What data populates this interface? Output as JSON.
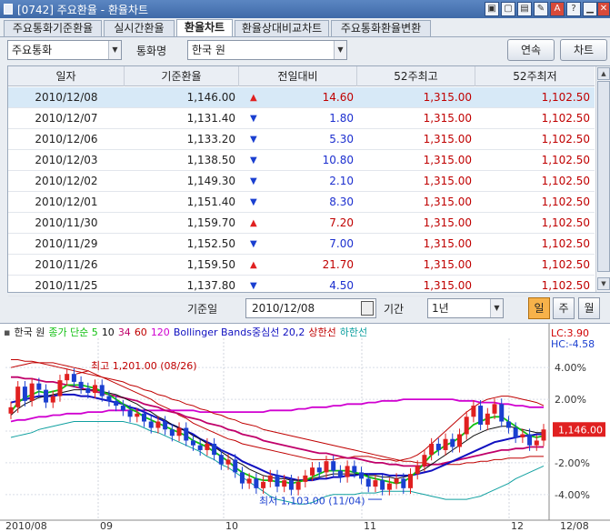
{
  "window": {
    "title": "[0742] 주요환율 - 환율차트"
  },
  "tabs": [
    {
      "label": "주요통화기준환율"
    },
    {
      "label": "실시간환율"
    },
    {
      "label": "환율차트"
    },
    {
      "label": "환율상대비교차트"
    },
    {
      "label": "주요통화환율변환"
    }
  ],
  "controls": {
    "category_value": "주요통화",
    "currency_label": "통화명",
    "currency_value": "한국 원",
    "continuous_button": "연속",
    "chart_button": "차트",
    "base_date_label": "기준일",
    "base_date_value": "2010/12/08",
    "period_label": "기간",
    "period_value": "1년",
    "period_day": "일",
    "period_week": "주",
    "period_month": "월"
  },
  "table": {
    "headers": [
      "일자",
      "기준환율",
      "전일대비",
      "52주최고",
      "52주최저"
    ],
    "rows": [
      {
        "date": "2010/12/08",
        "base": "1,146.00",
        "dir": "up",
        "change": "14.60",
        "high": "1,315.00",
        "low": "1,102.50"
      },
      {
        "date": "2010/12/07",
        "base": "1,131.40",
        "dir": "down",
        "change": "1.80",
        "high": "1,315.00",
        "low": "1,102.50"
      },
      {
        "date": "2010/12/06",
        "base": "1,133.20",
        "dir": "down",
        "change": "5.30",
        "high": "1,315.00",
        "low": "1,102.50"
      },
      {
        "date": "2010/12/03",
        "base": "1,138.50",
        "dir": "down",
        "change": "10.80",
        "high": "1,315.00",
        "low": "1,102.50"
      },
      {
        "date": "2010/12/02",
        "base": "1,149.30",
        "dir": "down",
        "change": "2.10",
        "high": "1,315.00",
        "low": "1,102.50"
      },
      {
        "date": "2010/12/01",
        "base": "1,151.40",
        "dir": "down",
        "change": "8.30",
        "high": "1,315.00",
        "low": "1,102.50"
      },
      {
        "date": "2010/11/30",
        "base": "1,159.70",
        "dir": "up",
        "change": "7.20",
        "high": "1,315.00",
        "low": "1,102.50"
      },
      {
        "date": "2010/11/29",
        "base": "1,152.50",
        "dir": "down",
        "change": "7.00",
        "high": "1,315.00",
        "low": "1,102.50"
      },
      {
        "date": "2010/11/26",
        "base": "1,159.50",
        "dir": "up",
        "change": "21.70",
        "high": "1,315.00",
        "low": "1,102.50"
      },
      {
        "date": "2010/11/25",
        "base": "1,137.80",
        "dir": "down",
        "change": "4.50",
        "high": "1,315.00",
        "low": "1,102.50"
      }
    ]
  },
  "colors": {
    "up": "#e02020",
    "down": "#1a3fd0",
    "upText": "#c00000",
    "downText": "#1c2fcf"
  },
  "chart_data": {
    "type": "line",
    "legend": [
      {
        "label": "한국 원",
        "color": "#222222"
      },
      {
        "label": "종가 단순 5",
        "color": "#10c010"
      },
      {
        "label": "10",
        "color": "#111111"
      },
      {
        "label": "34",
        "color": "#c0006a"
      },
      {
        "label": "60",
        "color": "#c00000"
      },
      {
        "label": "120",
        "color": "#d000d0"
      },
      {
        "label": "Bollinger Bands중심선 20,2",
        "color": "#1010c0"
      },
      {
        "label": "상한선",
        "color": "#c00000"
      },
      {
        "label": "하한선",
        "color": "#10a0a0"
      }
    ],
    "lc": "LC:3.90",
    "hc": "HC:-4.58",
    "y_ticks": [
      "4.00%",
      "2.00%",
      "0.00%",
      "-2.00%",
      "-4.00%"
    ],
    "x_ticks": [
      "2010/08",
      "09",
      "10",
      "11",
      "12",
      "12/08"
    ],
    "last_value": "1,146.00",
    "max_annotation": "최고 1,201.00 (08/26)",
    "min_annotation": "최저 1,103.00 (11/04)",
    "ylim": [
      -5.5,
      5.5
    ],
    "close": [
      1.5,
      2.8,
      1.9,
      3.0,
      2.6,
      1.8,
      2.2,
      3.2,
      3.6,
      3.1,
      2.7,
      2.4,
      2.9,
      2.2,
      1.9,
      1.6,
      1.3,
      0.9,
      1.1,
      0.6,
      0.2,
      0.6,
      0.1,
      -0.3,
      0.2,
      -0.6,
      -0.9,
      -1.2,
      -0.8,
      -1.5,
      -2.1,
      -1.8,
      -2.6,
      -3.3,
      -3.0,
      -3.6,
      -3.2,
      -2.8,
      -3.5,
      -3.1,
      -3.7,
      -3.2,
      -2.8,
      -2.3,
      -2.6,
      -1.9,
      -2.5,
      -2.9,
      -2.2,
      -2.6,
      -3.0,
      -3.5,
      -3.1,
      -3.7,
      -3.3,
      -3.0,
      -3.6,
      -2.7,
      -2.2,
      -1.5,
      -0.8,
      -1.2,
      -0.5,
      -1.0,
      -0.2,
      0.9,
      1.6,
      0.4,
      1.1,
      1.7,
      0.6,
      0.2,
      -0.4,
      -0.2,
      -0.9,
      -0.6,
      0.1
    ],
    "ma5": [
      1.2,
      1.8,
      2.1,
      2.3,
      2.5,
      2.4,
      2.5,
      2.6,
      2.9,
      2.9,
      2.9,
      2.8,
      2.7,
      2.5,
      2.3,
      2.0,
      1.7,
      1.4,
      1.2,
      0.9,
      0.7,
      0.5,
      0.3,
      0.1,
      -0.1,
      -0.3,
      -0.6,
      -0.8,
      -1.0,
      -1.3,
      -1.6,
      -1.9,
      -2.3,
      -2.6,
      -2.8,
      -3.0,
      -3.1,
      -3.1,
      -3.2,
      -3.2,
      -3.3,
      -3.2,
      -3.1,
      -2.9,
      -2.7,
      -2.5,
      -2.5,
      -2.5,
      -2.5,
      -2.6,
      -2.7,
      -2.9,
      -3.0,
      -3.1,
      -3.2,
      -3.3,
      -3.2,
      -2.9,
      -2.5,
      -2.0,
      -1.5,
      -1.2,
      -0.9,
      -0.7,
      -0.4,
      0.0,
      0.4,
      0.6,
      0.8,
      0.9,
      0.9,
      0.6,
      0.3,
      0.0,
      -0.3,
      -0.4,
      -0.3
    ],
    "ma10": [
      1.0,
      1.4,
      1.7,
      1.9,
      2.1,
      2.2,
      2.3,
      2.4,
      2.5,
      2.6,
      2.6,
      2.6,
      2.6,
      2.5,
      2.4,
      2.3,
      2.1,
      1.9,
      1.7,
      1.4,
      1.2,
      0.9,
      0.7,
      0.4,
      0.2,
      0.0,
      -0.3,
      -0.5,
      -0.8,
      -1.0,
      -1.3,
      -1.6,
      -1.9,
      -2.1,
      -2.4,
      -2.6,
      -2.8,
      -2.9,
      -3.0,
      -3.0,
      -3.1,
      -3.1,
      -3.1,
      -3.0,
      -2.9,
      -2.8,
      -2.7,
      -2.7,
      -2.7,
      -2.7,
      -2.7,
      -2.8,
      -2.8,
      -2.9,
      -2.9,
      -3.0,
      -2.9,
      -2.8,
      -2.6,
      -2.4,
      -2.1,
      -1.8,
      -1.5,
      -1.2,
      -0.9,
      -0.6,
      -0.3,
      -0.1,
      0.1,
      0.2,
      0.3,
      0.3,
      0.2,
      0.1,
      0.0,
      -0.1,
      -0.1
    ],
    "ma34": [
      3.4,
      3.4,
      3.3,
      3.3,
      3.2,
      3.1,
      3.1,
      3.0,
      2.9,
      2.8,
      2.7,
      2.6,
      2.5,
      2.4,
      2.3,
      2.2,
      2.1,
      2.0,
      1.9,
      1.7,
      1.6,
      1.5,
      1.3,
      1.2,
      1.1,
      0.9,
      0.8,
      0.7,
      0.5,
      0.4,
      0.3,
      0.1,
      0.0,
      -0.2,
      -0.3,
      -0.4,
      -0.6,
      -0.7,
      -0.8,
      -0.9,
      -1.0,
      -1.1,
      -1.2,
      -1.3,
      -1.4,
      -1.4,
      -1.5,
      -1.6,
      -1.7,
      -1.7,
      -1.8,
      -1.9,
      -2.0,
      -2.0,
      -2.1,
      -2.1,
      -2.2,
      -2.2,
      -2.2,
      -2.2,
      -2.1,
      -2.1,
      -2.0,
      -1.9,
      -1.8,
      -1.7,
      -1.6,
      -1.5,
      -1.4,
      -1.3,
      -1.2,
      -1.2,
      -1.1,
      -1.1,
      -1.0,
      -1.0,
      -1.0
    ],
    "ma60": [
      4.5,
      4.5,
      4.4,
      4.4,
      4.3,
      4.2,
      4.1,
      4.0,
      3.9,
      3.8,
      3.7,
      3.6,
      3.5,
      3.4,
      3.3,
      3.2,
      3.1,
      2.9,
      2.8,
      2.6,
      2.5,
      2.3,
      2.2,
      2.0,
      1.9,
      1.7,
      1.6,
      1.4,
      1.3,
      1.1,
      1.0,
      0.8,
      0.7,
      0.5,
      0.4,
      0.3,
      0.1,
      0.0,
      -0.1,
      -0.2,
      -0.3,
      -0.4,
      -0.5,
      -0.6,
      -0.7,
      -0.8,
      -0.9,
      -1.0,
      -1.1,
      -1.2,
      -1.3,
      -1.4,
      -1.5,
      -1.6,
      -1.7,
      -1.8,
      -1.9,
      -1.9,
      -2.0,
      -2.0,
      -2.1,
      -2.1,
      -2.1,
      -2.1,
      -2.1,
      -2.0,
      -2.0,
      -1.9,
      -1.9,
      -1.8,
      -1.8,
      -1.7,
      -1.7,
      -1.7,
      -1.6,
      -1.6,
      -1.6
    ],
    "ma120": [
      0.6,
      0.7,
      0.7,
      0.8,
      0.9,
      0.9,
      1.0,
      1.0,
      1.1,
      1.1,
      1.1,
      1.2,
      1.2,
      1.2,
      1.3,
      1.3,
      1.3,
      1.3,
      1.3,
      1.3,
      1.3,
      1.3,
      1.3,
      1.3,
      1.3,
      1.3,
      1.3,
      1.2,
      1.2,
      1.2,
      1.2,
      1.2,
      1.2,
      1.2,
      1.2,
      1.2,
      1.2,
      1.3,
      1.3,
      1.3,
      1.3,
      1.4,
      1.4,
      1.5,
      1.5,
      1.5,
      1.6,
      1.6,
      1.7,
      1.7,
      1.7,
      1.8,
      1.8,
      1.9,
      1.9,
      1.9,
      2.0,
      2.0,
      2.0,
      2.0,
      2.0,
      2.0,
      2.0,
      2.0,
      1.9,
      1.9,
      1.9,
      1.8,
      1.8,
      1.8,
      1.7,
      1.7,
      1.6,
      1.6,
      1.5,
      1.5,
      1.5
    ],
    "bb_mid": [
      1.8,
      1.9,
      2.0,
      2.1,
      2.2,
      2.2,
      2.2,
      2.3,
      2.3,
      2.3,
      2.2,
      2.2,
      2.1,
      2.0,
      1.9,
      1.8,
      1.7,
      1.5,
      1.4,
      1.2,
      1.0,
      0.8,
      0.6,
      0.4,
      0.2,
      0.0,
      -0.2,
      -0.5,
      -0.7,
      -0.9,
      -1.2,
      -1.4,
      -1.6,
      -1.9,
      -2.1,
      -2.3,
      -2.5,
      -2.7,
      -2.8,
      -2.9,
      -3.0,
      -3.1,
      -3.1,
      -3.1,
      -3.0,
      -3.0,
      -2.9,
      -2.9,
      -2.8,
      -2.8,
      -2.7,
      -2.7,
      -2.7,
      -2.7,
      -2.8,
      -2.8,
      -2.8,
      -2.8,
      -2.7,
      -2.6,
      -2.5,
      -2.3,
      -2.1,
      -1.9,
      -1.7,
      -1.5,
      -1.3,
      -1.1,
      -0.9,
      -0.7,
      -0.6,
      -0.5,
      -0.4,
      -0.3,
      -0.3,
      -0.2,
      -0.2
    ],
    "bb_upper": [
      4.0,
      4.1,
      4.2,
      4.3,
      4.3,
      4.3,
      4.3,
      4.2,
      4.1,
      4.0,
      3.9,
      3.8,
      3.6,
      3.4,
      3.2,
      3.0,
      2.8,
      2.6,
      2.4,
      2.2,
      2.0,
      1.7,
      1.5,
      1.3,
      1.0,
      0.8,
      0.5,
      0.3,
      0.1,
      -0.1,
      -0.3,
      -0.5,
      -0.6,
      -0.8,
      -0.9,
      -1.0,
      -1.1,
      -1.2,
      -1.3,
      -1.4,
      -1.5,
      -1.6,
      -1.7,
      -1.8,
      -1.8,
      -1.8,
      -1.8,
      -1.7,
      -1.7,
      -1.6,
      -1.6,
      -1.6,
      -1.7,
      -1.8,
      -1.8,
      -1.9,
      -1.8,
      -1.7,
      -1.5,
      -1.2,
      -0.8,
      -0.4,
      0.0,
      0.4,
      0.8,
      1.2,
      1.5,
      1.8,
      2.0,
      2.1,
      2.2,
      2.2,
      2.1,
      2.0,
      1.9,
      1.8,
      1.6
    ],
    "bb_lower": [
      -0.4,
      -0.3,
      -0.2,
      -0.1,
      0.1,
      0.2,
      0.3,
      0.4,
      0.5,
      0.6,
      0.6,
      0.6,
      0.6,
      0.6,
      0.6,
      0.6,
      0.6,
      0.5,
      0.4,
      0.2,
      0.0,
      -0.1,
      -0.3,
      -0.5,
      -0.7,
      -0.9,
      -1.1,
      -1.3,
      -1.6,
      -1.8,
      -2.1,
      -2.3,
      -2.6,
      -2.9,
      -3.2,
      -3.5,
      -3.8,
      -4.1,
      -4.3,
      -4.4,
      -4.5,
      -4.6,
      -4.6,
      -4.5,
      -4.3,
      -4.1,
      -4.0,
      -4.0,
      -4.0,
      -4.0,
      -3.9,
      -3.9,
      -3.9,
      -3.8,
      -3.8,
      -3.8,
      -3.8,
      -3.8,
      -3.9,
      -4.0,
      -4.1,
      -4.2,
      -4.3,
      -4.3,
      -4.3,
      -4.3,
      -4.2,
      -4.1,
      -3.9,
      -3.7,
      -3.5,
      -3.3,
      -3.0,
      -2.8,
      -2.6,
      -2.4,
      -2.2
    ]
  }
}
